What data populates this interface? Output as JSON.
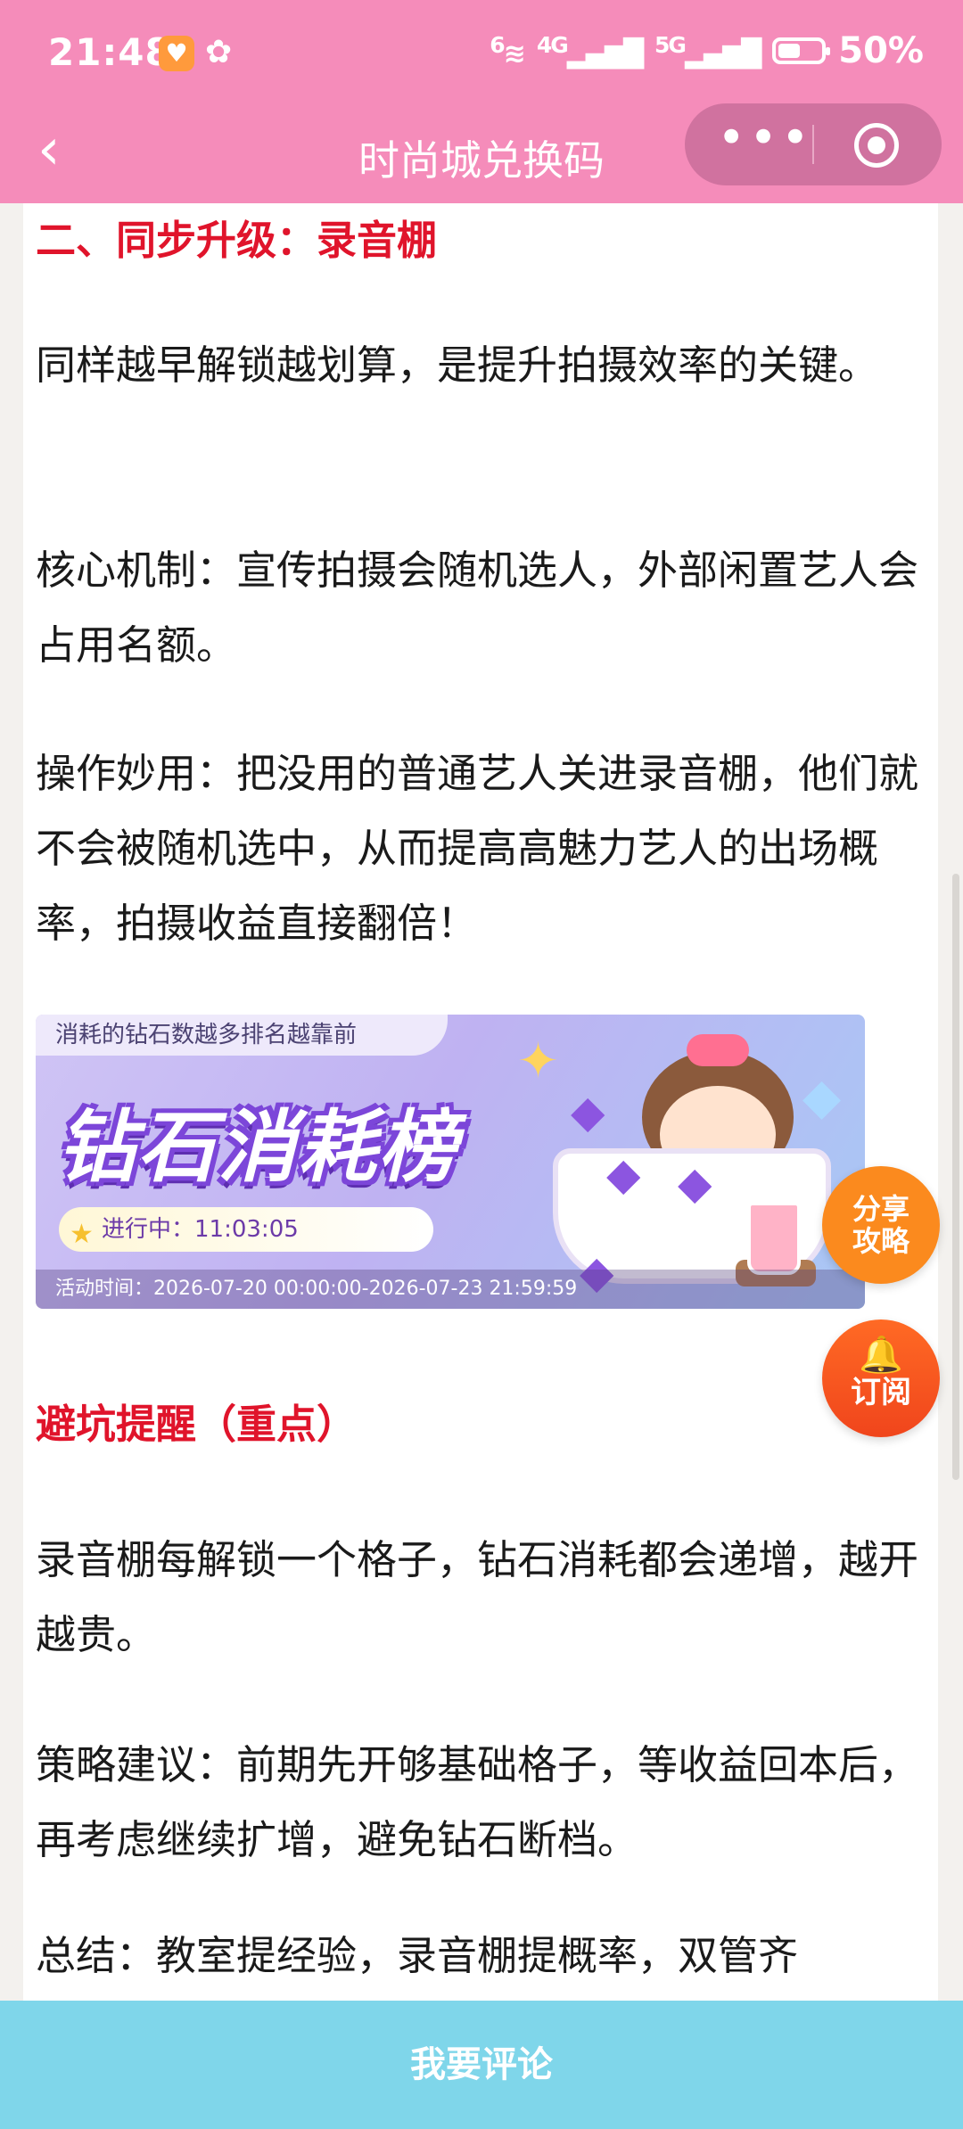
{
  "status_bar": {
    "time": "21:48",
    "network_4g": "4G",
    "network_5g": "5G",
    "wifi_sub": "6",
    "battery": "50%"
  },
  "nav": {
    "back_icon": "‹",
    "title": "时尚城兑换码",
    "more_icon": "•••"
  },
  "article": {
    "heading_section2": "二、同步升级：录音棚",
    "p1": "同样越早解锁越划算，是提升拍摄效率的关键。",
    "p2": "核心机制：宣传拍摄会随机选人，外部闲置艺人会占用名额。",
    "p3": "操作妙用：把没用的普通艺人关进录音棚，他们就不会被随机选中，从而提高高魅力艺人的出场概率，拍摄收益直接翻倍！",
    "banner": {
      "caption": "消耗的钻石数越多排名越靠前",
      "title": "钻石消耗榜",
      "status": "进行中：11:03:05",
      "footer": "活动时间：2026-07-20 00:00:00-2026-07-23 21:59:59"
    },
    "heading_warning": "避坑提醒（重点）",
    "p4": "录音棚每解锁一个格子，钻石消耗都会递增，越开越贵。",
    "p5": "策略建议：前期先开够基础格子，等收益回本后，再考虑继续扩增，避免钻石断档。",
    "p6": "总结：教室提经验，录音棚提概率，双管齐"
  },
  "fab": {
    "share_line1": "分享",
    "share_line2": "攻略",
    "subscribe": "订阅"
  },
  "bottom": {
    "comment_label": "我要评论"
  },
  "colors": {
    "brand_pink": "#f58cba",
    "heading_red": "#e0142b",
    "comment_bar": "#7fd6ea",
    "fab_orange": "#fb8a1e"
  }
}
